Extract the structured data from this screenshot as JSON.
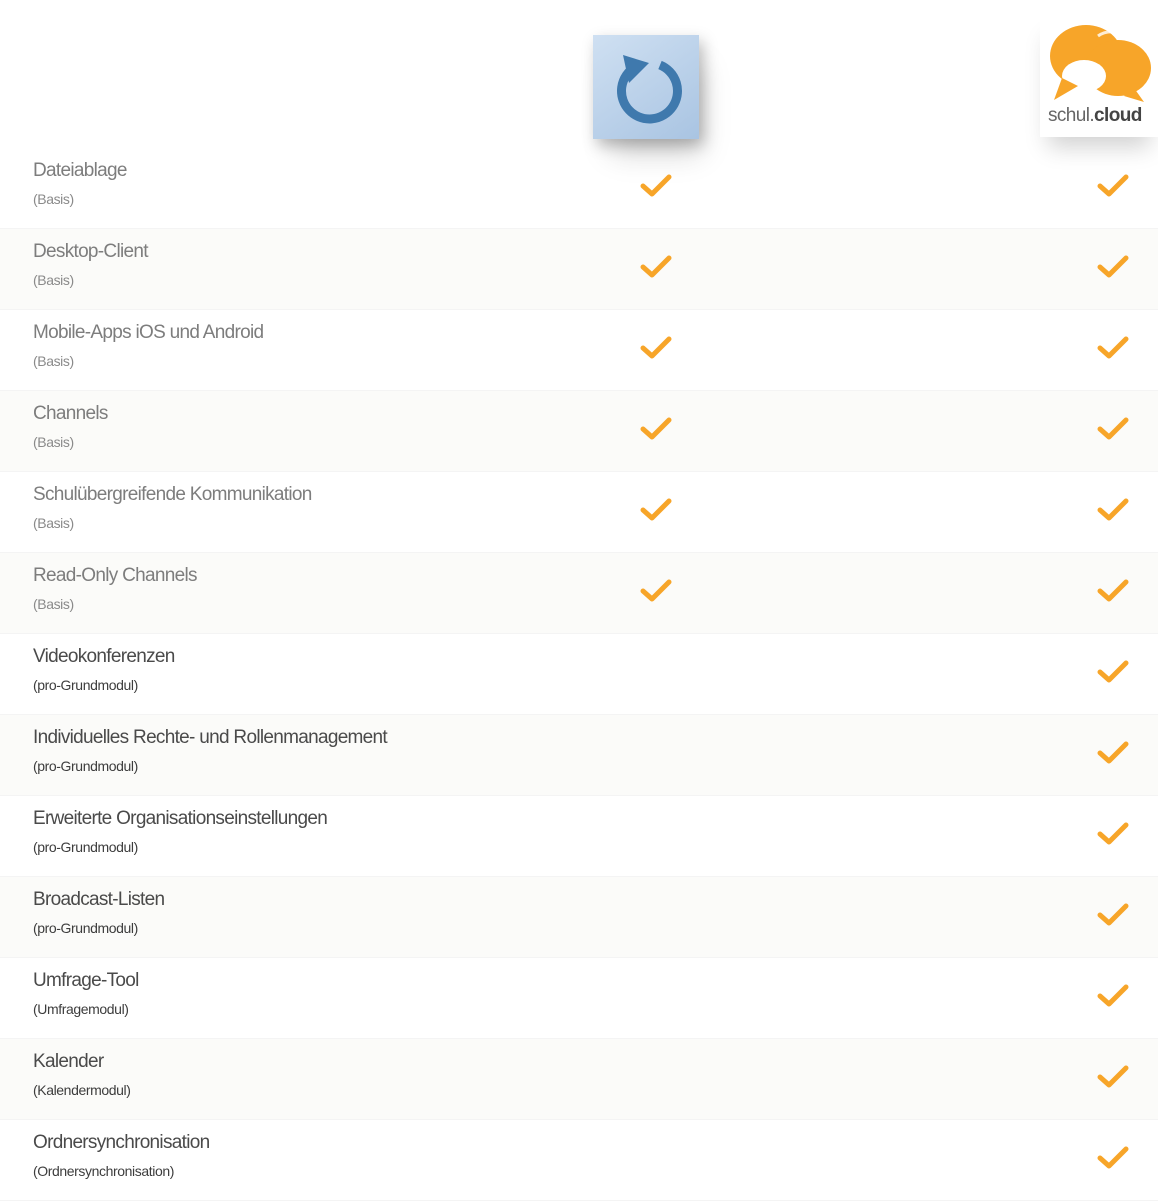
{
  "products": [
    {
      "name": "refresh-logo",
      "icon": "refresh-icon",
      "color": "#3f79ad"
    },
    {
      "name": "schul.cloud",
      "label_light": "schul.",
      "label_bold": "cloud",
      "icon": "speech-bubbles-icon",
      "color": "#f7a529"
    }
  ],
  "check_color": "#f7a529",
  "features": [
    {
      "label": "Dateiablage",
      "note": "(Basis)",
      "col1": true,
      "col2": true
    },
    {
      "label": "Desktop-Client",
      "note": "(Basis)",
      "col1": true,
      "col2": true
    },
    {
      "label": "Mobile-Apps iOS und Android",
      "note": "(Basis)",
      "col1": true,
      "col2": true
    },
    {
      "label": "Channels",
      "note": "(Basis)",
      "col1": true,
      "col2": true
    },
    {
      "label": "Schulübergreifende Kommunikation",
      "note": "(Basis)",
      "col1": true,
      "col2": true
    },
    {
      "label": "Read-Only Channels",
      "note": "(Basis)",
      "col1": true,
      "col2": true
    },
    {
      "label": "Videokonferenzen",
      "note": "(pro-Grundmodul)",
      "col1": false,
      "col2": true
    },
    {
      "label": "Individuelles Rechte- und Rollenmanagement",
      "note": "(pro-Grundmodul)",
      "col1": false,
      "col2": true
    },
    {
      "label": "Erweiterte Organisationseinstellungen",
      "note": "(pro-Grundmodul)",
      "col1": false,
      "col2": true
    },
    {
      "label": "Broadcast-Listen",
      "note": "(pro-Grundmodul)",
      "col1": false,
      "col2": true
    },
    {
      "label": "Umfrage-Tool",
      "note": "(Umfragemodul)",
      "col1": false,
      "col2": true
    },
    {
      "label": "Kalender",
      "note": "(Kalendermodul)",
      "col1": false,
      "col2": true
    },
    {
      "label": "Ordnersynchronisation",
      "note": "(Ordnersynchronisation)",
      "col1": false,
      "col2": true
    }
  ]
}
